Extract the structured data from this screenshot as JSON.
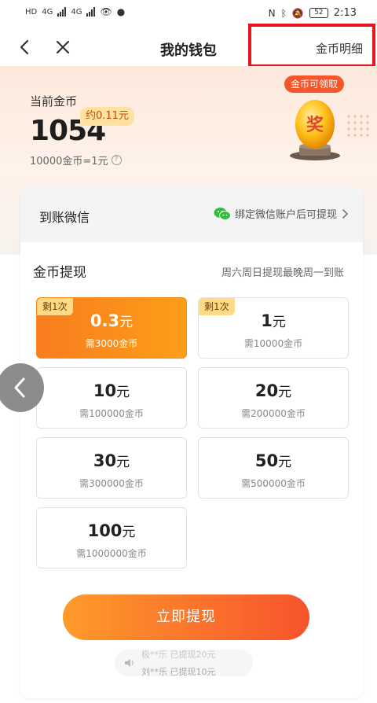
{
  "status_bar": {
    "net1": "HD",
    "net2": "HD",
    "sig1": "4G",
    "sig2": "4G",
    "battery": "52",
    "time": "2:13"
  },
  "nav": {
    "title": "我的钱包",
    "detail_link": "金币明细"
  },
  "header": {
    "coin_label": "当前金币",
    "coin_amount": "1054",
    "yuan_badge": "约0.11元",
    "rate": "10000金币=1元",
    "help": "?",
    "egg_badge": "金币可领取",
    "egg_char": "奖"
  },
  "wechat": {
    "title": "到账微信",
    "bind_text": "绑定微信账户后可提现"
  },
  "withdraw": {
    "title": "金币提现",
    "note": "周六周日提现最晚周一到账",
    "options": [
      {
        "amount": "0.3",
        "unit": "元",
        "need": "需3000金币",
        "tag": "剩1次"
      },
      {
        "amount": "1",
        "unit": "元",
        "need": "需10000金币",
        "tag": "剩1次"
      },
      {
        "amount": "10",
        "unit": "元",
        "need": "需100000金币"
      },
      {
        "amount": "20",
        "unit": "元",
        "need": "需200000金币"
      },
      {
        "amount": "30",
        "unit": "元",
        "need": "需300000金币"
      },
      {
        "amount": "50",
        "unit": "元",
        "need": "需500000金币"
      },
      {
        "amount": "100",
        "unit": "元",
        "need": "需1000000金币"
      }
    ],
    "selected_index": 0,
    "button": "立即提现"
  },
  "ticker": {
    "line1": "极**乐 已提现20元",
    "line2": "刘**乐 已提现10元"
  },
  "colors": {
    "accent": "#fa8a1c",
    "button_start": "#fe9b2b",
    "button_end": "#f7532c",
    "highlight": "#e8131f",
    "badge": "#f5562a"
  }
}
